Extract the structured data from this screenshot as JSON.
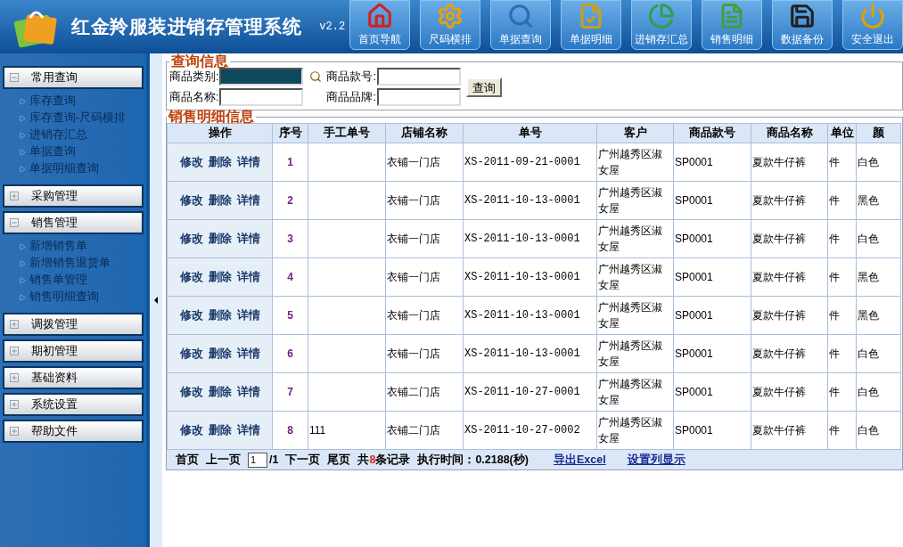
{
  "header": {
    "title": "红金羚服装进销存管理系统",
    "version": "v2.2",
    "toolbar": [
      {
        "label": "首页导航",
        "kind": "home"
      },
      {
        "label": "尺码横排",
        "kind": "gears"
      },
      {
        "label": "单据查询",
        "kind": "search"
      },
      {
        "label": "单据明细",
        "kind": "note"
      },
      {
        "label": "进销存汇总",
        "kind": "pie"
      },
      {
        "label": "销售明细",
        "kind": "doc"
      },
      {
        "label": "数据备份",
        "kind": "save"
      },
      {
        "label": "安全退出",
        "kind": "power"
      }
    ]
  },
  "sidebar": {
    "groups": [
      {
        "label": "常用查询",
        "expanded": true,
        "items": [
          "库存查询",
          "库存查询-尺码横排",
          "进销存汇总",
          "单据查询",
          "单据明细查询"
        ]
      },
      {
        "label": "采购管理",
        "expanded": false
      },
      {
        "label": "销售管理",
        "expanded": true,
        "items": [
          "新增销售单",
          "新增销售退货单",
          "销售单管理",
          "销售明细查询"
        ]
      },
      {
        "label": "调拨管理",
        "expanded": false
      },
      {
        "label": "期初管理",
        "expanded": false
      },
      {
        "label": "基础资料",
        "expanded": false
      },
      {
        "label": "系统设置",
        "expanded": false
      },
      {
        "label": "帮助文件",
        "expanded": false
      }
    ]
  },
  "query": {
    "title": "查询信息",
    "fields": [
      {
        "label": "商品类别:",
        "kind": "picker"
      },
      {
        "label": "商品款号:",
        "kind": "text"
      },
      {
        "label": "商品名称:",
        "kind": "text"
      },
      {
        "label": "商品品牌:",
        "kind": "text"
      }
    ],
    "button": "查询"
  },
  "results": {
    "title": "销售明细信息",
    "columns": [
      "操作",
      "序号",
      "手工单号",
      "店铺名称",
      "单号",
      "客户",
      "商品款号",
      "商品名称",
      "单位",
      "颜"
    ],
    "rows": [
      [
        [
          "修改",
          "删除",
          "详情"
        ],
        "1",
        "",
        "衣铺一门店",
        "XS-2011-09-21-0001",
        "广州越秀区淑女屋",
        "SP0001",
        "夏款牛仔裤",
        "件",
        "白色"
      ],
      [
        [
          "修改",
          "删除",
          "详情"
        ],
        "2",
        "",
        "衣铺一门店",
        "XS-2011-10-13-0001",
        "广州越秀区淑女屋",
        "SP0001",
        "夏款牛仔裤",
        "件",
        "黑色"
      ],
      [
        [
          "修改",
          "删除",
          "详情"
        ],
        "3",
        "",
        "衣铺一门店",
        "XS-2011-10-13-0001",
        "广州越秀区淑女屋",
        "SP0001",
        "夏款牛仔裤",
        "件",
        "白色"
      ],
      [
        [
          "修改",
          "删除",
          "详情"
        ],
        "4",
        "",
        "衣铺一门店",
        "XS-2011-10-13-0001",
        "广州越秀区淑女屋",
        "SP0001",
        "夏款牛仔裤",
        "件",
        "黑色"
      ],
      [
        [
          "修改",
          "删除",
          "详情"
        ],
        "5",
        "",
        "衣铺一门店",
        "XS-2011-10-13-0001",
        "广州越秀区淑女屋",
        "SP0001",
        "夏款牛仔裤",
        "件",
        "黑色"
      ],
      [
        [
          "修改",
          "删除",
          "详情"
        ],
        "6",
        "",
        "衣铺一门店",
        "XS-2011-10-13-0001",
        "广州越秀区淑女屋",
        "SP0001",
        "夏款牛仔裤",
        "件",
        "白色"
      ],
      [
        [
          "修改",
          "删除",
          "详情"
        ],
        "7",
        "",
        "衣铺二门店",
        "XS-2011-10-27-0001",
        "广州越秀区淑女屋",
        "SP0001",
        "夏款牛仔裤",
        "件",
        "白色"
      ],
      [
        [
          "修改",
          "删除",
          "详情"
        ],
        "8",
        "111",
        "衣铺二门店",
        "XS-2011-10-27-0002",
        "广州越秀区淑女屋",
        "SP0001",
        "夏款牛仔裤",
        "件",
        "白色"
      ]
    ],
    "pager": {
      "first": "首页",
      "prev": "上一页",
      "page": "1",
      "total_pages": "/1",
      "next": "下一页",
      "last": "尾页",
      "count_prefix": "共",
      "count": "8",
      "count_suffix": "条记录",
      "elapsed": "执行时间：0.2188(秒)",
      "export": "导出Excel",
      "columns_setting": "设置列显示"
    }
  }
}
